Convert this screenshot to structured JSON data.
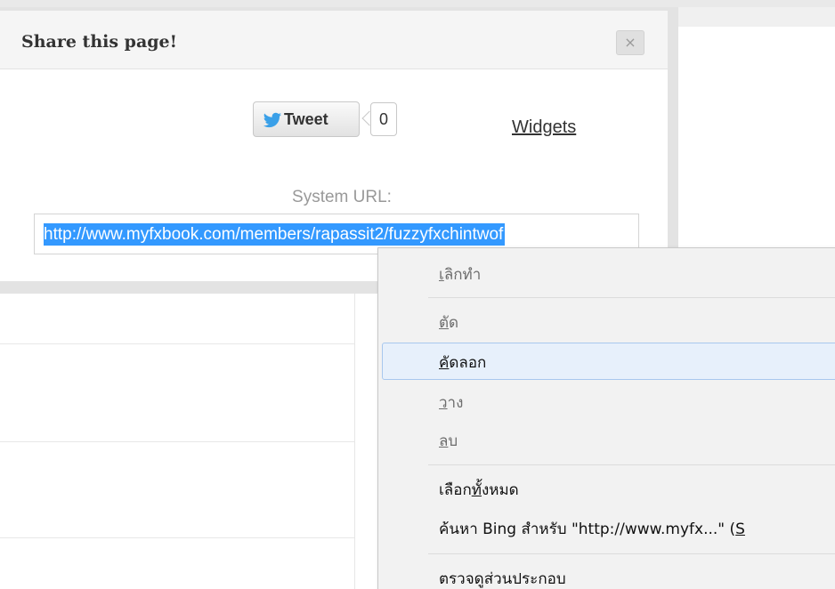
{
  "modal": {
    "title": "Share this page!",
    "close_glyph": "×",
    "tweet": {
      "label": "Tweet",
      "count": "0",
      "icon": "twitter-bird-icon"
    },
    "widgets_link": "Widgets",
    "url_label": "System URL:",
    "url_value": "http://www.myfxbook.com/members/rapassit2/fuzzyfxchintwof"
  },
  "context_menu": {
    "items": [
      {
        "accel": "เ",
        "rest": "ลิกทำ",
        "enabled": false
      },
      {
        "accel": "ตั",
        "rest": "ด",
        "enabled": false
      },
      {
        "accel": "คั",
        "rest": "ดลอก",
        "enabled": true,
        "highlighted": true
      },
      {
        "accel": "ว",
        "rest": "าง",
        "enabled": false
      },
      {
        "accel": "ล",
        "rest": "บ",
        "enabled": false
      },
      {
        "pre": "เลือก",
        "accel": "ทั้",
        "rest": "งหมด",
        "enabled": true
      },
      {
        "pre": "ค้นหา Bing  สำหรับ  \"http://www.myfx...\" (",
        "accel": "S",
        "rest": "",
        "enabled": true
      },
      {
        "pre": "ตรวจดูส่วนประกอบ",
        "enabled": true
      }
    ]
  },
  "colors": {
    "selection": "#3399ff",
    "hover": "#e7f0fb"
  }
}
